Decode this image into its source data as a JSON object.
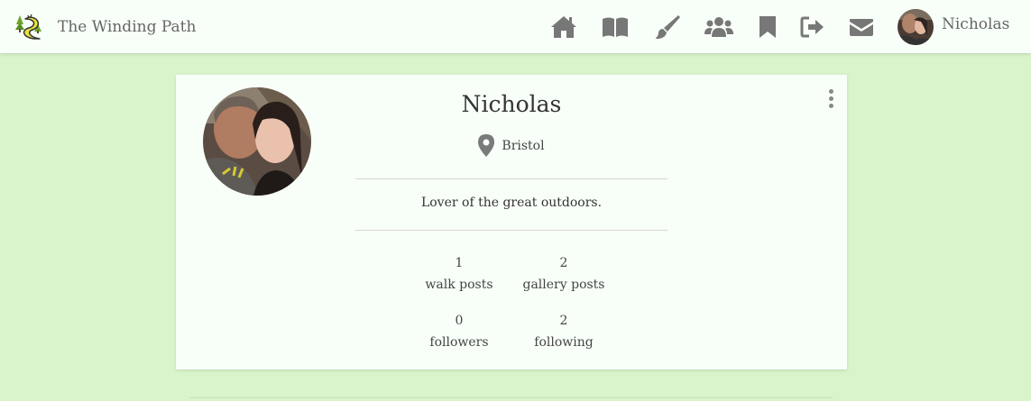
{
  "navbar": {
    "brand_text": "The Winding Path",
    "username": "Nicholas",
    "icons": [
      "home-icon",
      "book-icon",
      "brush-icon",
      "users-icon",
      "bookmark-icon",
      "sign-out-icon",
      "envelope-icon"
    ],
    "icon_color": "#777777"
  },
  "profile": {
    "name": "Nicholas",
    "location": "Bristol",
    "bio": "Lover of the great outdoors.",
    "stats": {
      "walk_posts": {
        "count": "1",
        "label": "walk posts"
      },
      "gallery_posts": {
        "count": "2",
        "label": "gallery posts"
      },
      "followers": {
        "count": "0",
        "label": "followers"
      },
      "following": {
        "count": "2",
        "label": "following"
      }
    }
  },
  "colors": {
    "background": "#d9f4cb",
    "card": "#f8fff8",
    "text": "#333333"
  }
}
